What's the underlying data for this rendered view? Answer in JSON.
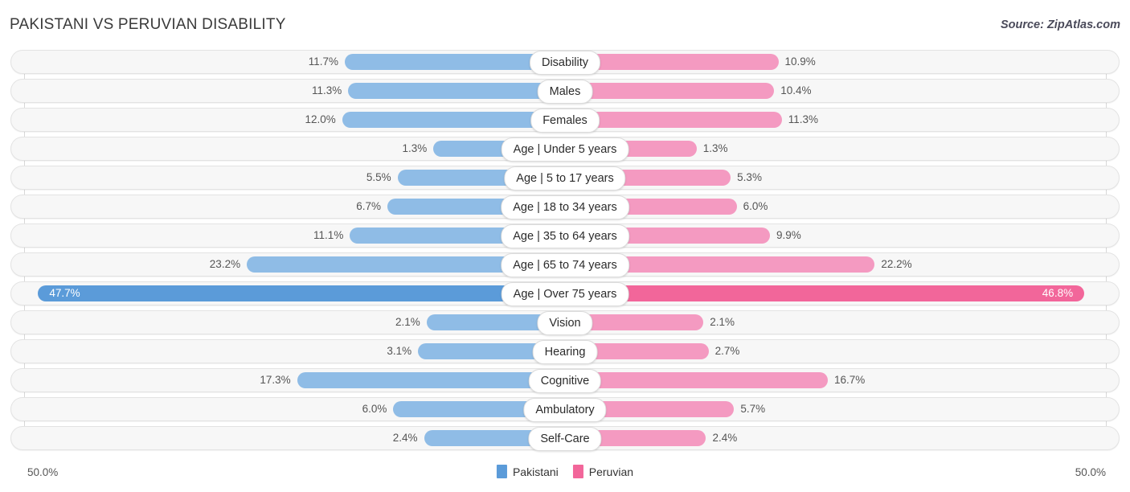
{
  "header": {
    "title": "PAKISTANI VS PERUVIAN DISABILITY",
    "source": "Source: ZipAtlas.com"
  },
  "axis": {
    "left_label": "50.0%",
    "right_label": "50.0%"
  },
  "legend": {
    "items": [
      {
        "label": "Pakistani",
        "color": "#5b9bd9",
        "swatch_name": "legend-swatch-pakistani"
      },
      {
        "label": "Peruvian",
        "color": "#f2669a",
        "swatch_name": "legend-swatch-peruvian"
      }
    ]
  },
  "colors": {
    "left_bar": "#8fbce6",
    "right_bar": "#f49ac1",
    "left_bar_highlight": "#5b9bd9",
    "right_bar_highlight": "#f2669a",
    "row_track": "#f7f7f7",
    "gridline": "#d8d8d8"
  },
  "chart_data": {
    "type": "bar",
    "title": "PAKISTANI VS PERUVIAN DISABILITY",
    "subtitle": "Source: ZipAtlas.com",
    "orientation": "horizontal-diverging",
    "xlabel": "",
    "ylabel": "",
    "xlim": [
      50.0,
      50.0
    ],
    "axis_tick_labels": [
      "50.0%",
      "50.0%"
    ],
    "grid": true,
    "legend_position": "bottom-center",
    "categories": [
      "Disability",
      "Males",
      "Females",
      "Age | Under 5 years",
      "Age | 5 to 17 years",
      "Age | 18 to 34 years",
      "Age | 35 to 64 years",
      "Age | 65 to 74 years",
      "Age | Over 75 years",
      "Vision",
      "Hearing",
      "Cognitive",
      "Ambulatory",
      "Self-Care"
    ],
    "series": [
      {
        "name": "Pakistani",
        "color": "#8fbce6",
        "values": [
          11.7,
          11.3,
          12.0,
          1.3,
          5.5,
          6.7,
          11.1,
          23.2,
          47.7,
          2.1,
          3.1,
          17.3,
          6.0,
          2.4
        ],
        "labels": [
          "11.7%",
          "11.3%",
          "12.0%",
          "1.3%",
          "5.5%",
          "6.7%",
          "11.1%",
          "23.2%",
          "47.7%",
          "2.1%",
          "3.1%",
          "17.3%",
          "6.0%",
          "2.4%"
        ]
      },
      {
        "name": "Peruvian",
        "color": "#f49ac1",
        "values": [
          10.9,
          10.4,
          11.3,
          1.3,
          5.3,
          6.0,
          9.9,
          22.2,
          46.8,
          2.1,
          2.7,
          16.7,
          5.7,
          2.4
        ],
        "labels": [
          "10.9%",
          "10.4%",
          "11.3%",
          "1.3%",
          "5.3%",
          "6.0%",
          "9.9%",
          "22.2%",
          "46.8%",
          "2.1%",
          "2.7%",
          "16.7%",
          "5.7%",
          "2.4%"
        ]
      }
    ],
    "highlighted_categories": [
      "Age | Over 75 years"
    ]
  }
}
